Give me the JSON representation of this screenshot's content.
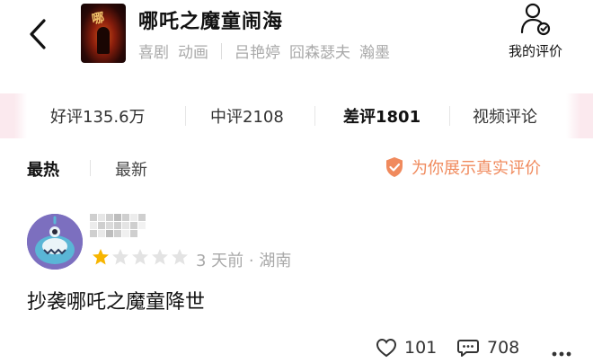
{
  "header": {
    "title": "哪吒之魔童闹海",
    "genres": [
      "喜剧",
      "动画"
    ],
    "cast": [
      "吕艳婷",
      "囧森瑟夫",
      "瀚墨"
    ],
    "my_review_label": "我的评价",
    "poster_logo": "哪"
  },
  "filters": [
    {
      "label": "好评135.6万",
      "active": false
    },
    {
      "label": "中评2108",
      "active": false
    },
    {
      "label": "差评1801",
      "active": true
    },
    {
      "label": "视频评论",
      "active": false
    }
  ],
  "sort": {
    "hot_label": "最热",
    "new_label": "最新",
    "selected": "最热"
  },
  "verified_label": "为你展示真实评价",
  "review": {
    "rating": 1,
    "max_rating": 5,
    "time_location": "3 天前 · 湖南",
    "text": "抄袭哪吒之魔童降世",
    "likes": "101",
    "comments": "708"
  },
  "colors": {
    "accent_orange": "#f08a5d",
    "star_filled": "#f7b500",
    "star_empty": "#e3e3e3",
    "avatar_bg": "#7c6fbf"
  },
  "icons": {
    "back": "chevron-left-icon",
    "my_review": "user-review-icon",
    "verified": "shield-check-icon",
    "like": "heart-icon",
    "comment": "comment-bubble-icon",
    "more": "more-dots-icon"
  }
}
